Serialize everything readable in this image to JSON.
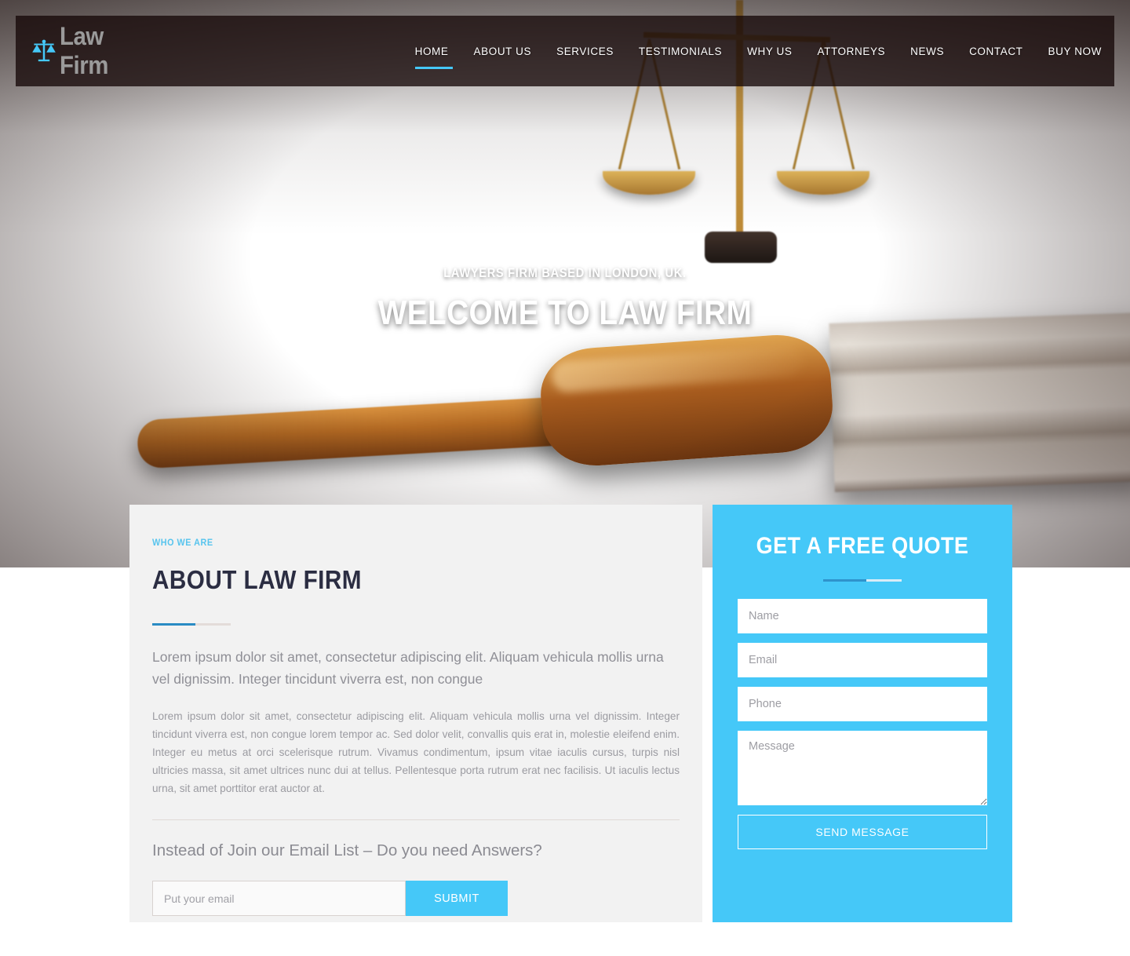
{
  "colors": {
    "accent": "#45c8f8",
    "accent_dark": "#2a8bc4",
    "eyebrow": "#57c4ee",
    "heading": "#2b2d42",
    "panel_bg": "#f2f2f2",
    "header_bar": "rgba(22,8,8,0.78)"
  },
  "header": {
    "logo_icon": "scales-of-justice-icon",
    "logo_text": "Law Firm",
    "nav": [
      {
        "label": "HOME",
        "active": true
      },
      {
        "label": "ABOUT US",
        "active": false
      },
      {
        "label": "SERVICES",
        "active": false
      },
      {
        "label": "TESTIMONIALS",
        "active": false
      },
      {
        "label": "WHY US",
        "active": false
      },
      {
        "label": "ATTORNEYS",
        "active": false
      },
      {
        "label": "NEWS",
        "active": false
      },
      {
        "label": "CONTACT",
        "active": false
      },
      {
        "label": "BUY NOW",
        "active": false
      }
    ]
  },
  "hero": {
    "subtitle": "LAWYERS FIRM BASED IN LONDON, UK.",
    "title": "WELCOME TO LAW FIRM"
  },
  "about": {
    "eyebrow": "WHO WE ARE",
    "title": "ABOUT LAW FIRM",
    "lead": "Lorem ipsum dolor sit amet, consectetur adipiscing elit. Aliquam vehicula mollis urna vel dignissim. Integer tincidunt viverra est, non congue",
    "body": "Lorem ipsum dolor sit amet, consectetur adipiscing elit. Aliquam vehicula mollis urna vel dignissim. Integer tincidunt viverra est, non congue lorem tempor ac. Sed dolor velit, convallis quis erat in, molestie eleifend enim. Integer eu metus at orci scelerisque rutrum. Vivamus condimentum, ipsum vitae iaculis cursus, turpis nisl ultricies massa, sit amet ultrices nunc dui at tellus. Pellentesque porta rutrum erat nec facilisis. Ut iaculis lectus urna, sit amet porttitor erat auctor at.",
    "subscribe_title": "Instead of Join our Email List – Do you need Answers?",
    "email_placeholder": "Put your email",
    "email_value": "",
    "submit_label": "SUBMIT"
  },
  "quote": {
    "title": "GET A FREE QUOTE",
    "name_placeholder": "Name",
    "name_value": "",
    "email_placeholder": "Email",
    "email_value": "",
    "phone_placeholder": "Phone",
    "phone_value": "",
    "message_placeholder": "Message",
    "message_value": "",
    "send_label": "SEND MESSAGE"
  }
}
